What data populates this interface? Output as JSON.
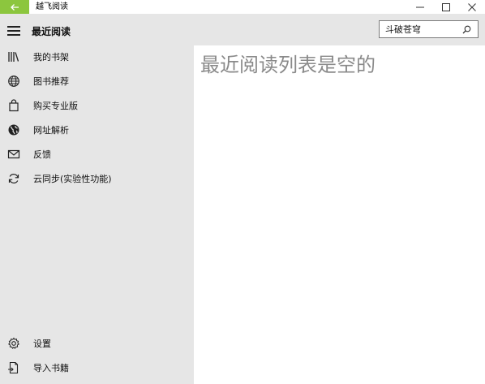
{
  "titlebar": {
    "app_title": "越飞阅读",
    "back_glyph": "🡐",
    "controls": {
      "minimize": "—",
      "maximize": "☐",
      "close": "✕"
    }
  },
  "nav": {
    "title": "最近阅读",
    "items": [
      {
        "label": "我的书架",
        "icon": "bookshelf-icon"
      },
      {
        "label": "图书推荐",
        "icon": "globe-icon"
      },
      {
        "label": "购买专业版",
        "icon": "shopping-bag-icon"
      },
      {
        "label": "网址解析",
        "icon": "earth-icon"
      },
      {
        "label": "反馈",
        "icon": "mail-icon"
      },
      {
        "label": "云同步(实验性功能)",
        "icon": "sync-icon"
      }
    ],
    "bottom_items": [
      {
        "label": "设置",
        "icon": "gear-icon"
      },
      {
        "label": "导入书籍",
        "icon": "import-file-icon"
      }
    ]
  },
  "search": {
    "value": "斗破苍穹"
  },
  "main": {
    "empty_message": "最近阅读列表是空的"
  },
  "colors": {
    "accent": "#8cc63e",
    "pane": "#e6e6e6",
    "muted_text": "#8a8a8a"
  }
}
